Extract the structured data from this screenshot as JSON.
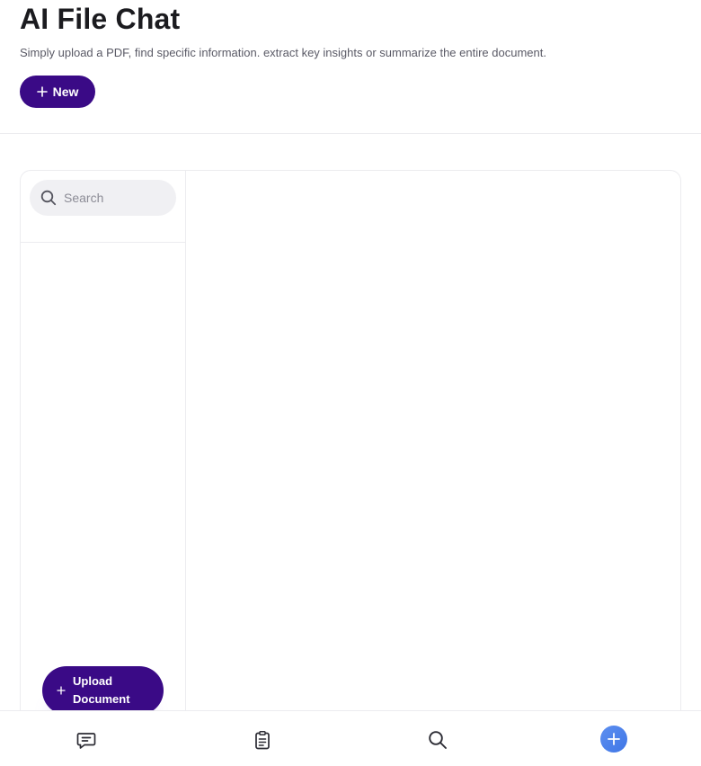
{
  "header": {
    "title": "AI File Chat",
    "subtitle": "Simply upload a PDF, find specific information. extract key insights or summarize the entire document.",
    "new_button_label": "New"
  },
  "sidebar": {
    "search": {
      "placeholder": "Search",
      "value": ""
    },
    "upload_button_label_line1": "Upload",
    "upload_button_label_line2": "Document"
  },
  "bottom_nav": {
    "items": [
      {
        "icon": "chat-icon"
      },
      {
        "icon": "clipboard-icon"
      },
      {
        "icon": "search-icon"
      },
      {
        "icon": "add-icon"
      }
    ]
  },
  "colors": {
    "primary": "#3a0a86",
    "accent_blue": "#4a80ea",
    "border": "#ececef",
    "search_bg": "#f0f0f3"
  }
}
